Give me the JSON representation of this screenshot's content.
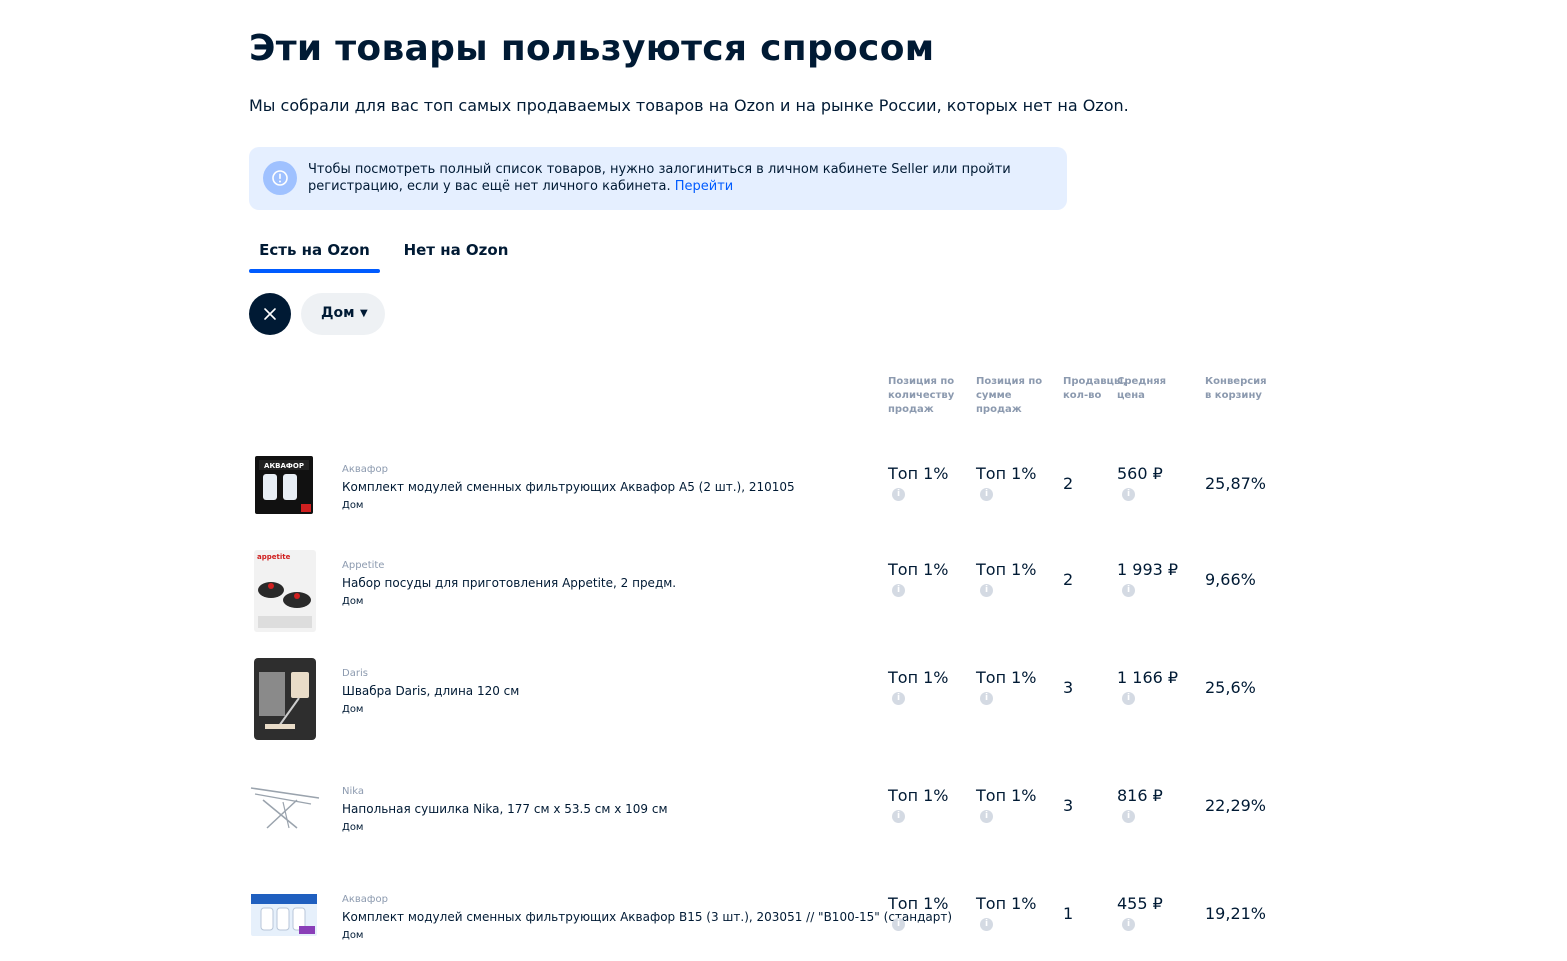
{
  "header": {
    "title": "Эти товары пользуются спросом",
    "subtitle": "Мы собрали для вас топ самых продаваемых товаров на Ozon и на рынке России, которых нет на Ozon."
  },
  "notice": {
    "icon": "exclamation-icon",
    "text": "Чтобы посмотреть полный список товаров, нужно залогиниться в личном кабинете Seller или пройти регистрацию, если у вас ещё нет личного кабинета.",
    "link_label": "Перейти"
  },
  "tabs": [
    {
      "label": "Есть на Ozon",
      "active": true
    },
    {
      "label": "Нет на Ozon",
      "active": false
    }
  ],
  "filters": {
    "clear_icon": "close-icon",
    "chip_label": "Дом",
    "chip_arrow": "▼"
  },
  "columns": {
    "pos_qty": "Позиция по количеству продаж",
    "pos_sum": "Позиция по сумме продаж",
    "sellers": "Продавцы, кол-во",
    "avg_price": "Средняя цена",
    "conversion": "Конверсия в корзину"
  },
  "products": [
    {
      "brand": "Аквафор",
      "name": "Комплект модулей сменных фильтрующих Аквафор A5 (2 шт.), 210105",
      "category": "Дом",
      "pos_qty": "Топ 1%",
      "pos_sum": "Топ 1%",
      "sellers": "2",
      "price": "560 ₽",
      "conversion": "25,87%"
    },
    {
      "brand": "Appetite",
      "name": "Набор посуды для приготовления Appetite, 2 предм.",
      "category": "Дом",
      "pos_qty": "Топ 1%",
      "pos_sum": "Топ 1%",
      "sellers": "2",
      "price": "1 993 ₽",
      "conversion": "9,66%"
    },
    {
      "brand": "Daris",
      "name": "Швабра Daris, длина 120 см",
      "category": "Дом",
      "pos_qty": "Топ 1%",
      "pos_sum": "Топ 1%",
      "sellers": "3",
      "price": "1 166 ₽",
      "conversion": "25,6%"
    },
    {
      "brand": "Nika",
      "name": "Напольная сушилка Nika, 177 см х 53.5 см х 109 см",
      "category": "Дом",
      "pos_qty": "Топ 1%",
      "pos_sum": "Топ 1%",
      "sellers": "3",
      "price": "816 ₽",
      "conversion": "22,29%"
    },
    {
      "brand": "Аквафор",
      "name": "Комплект модулей сменных фильтрующих Аквафор B15 (3 шт.), 203051 // \"B100-15\" (стандарт)",
      "category": "Дом",
      "pos_qty": "Топ 1%",
      "pos_sum": "Топ 1%",
      "sellers": "1",
      "price": "455 ₽",
      "conversion": "19,21%"
    }
  ],
  "colors": {
    "accent": "#005bff",
    "text": "#001a34",
    "muted": "#8c9aaf",
    "notice_bg": "#e5efff"
  }
}
